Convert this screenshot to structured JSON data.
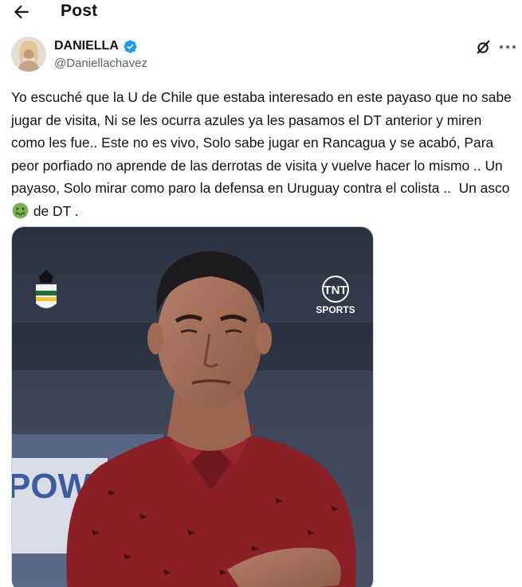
{
  "header": {
    "title": "Post"
  },
  "author": {
    "display_name": "DANIELLA",
    "handle": "@Daniellachavez",
    "verified": true
  },
  "tweet": {
    "text_before_emoji": "Yo escuché que la U de Chile que estaba interesado en este payaso que no sabe jugar de visita, Ni se les ocurra azules ya les pasamos el DT anterior y miren como les fue.. Este no es vivo, Solo sabe jugar en Rancagua y se acabó, Para peor porfiado no aprende de las derrotas de visita y vuelve hacer lo mismo .. Un payaso, Solo mirar como paro la defensa en Uruguay contra el colista ..  Un asco",
    "emoji": "nauseated-face",
    "text_after_emoji": " de DT ."
  },
  "media": {
    "watermark_line1": "TNT",
    "watermark_line2": "SPORTS",
    "background_sign": "POWER"
  },
  "colors": {
    "accent": "#1d9bf0",
    "text": "#0f1419",
    "muted": "#536471",
    "shirt": "#8a1f26"
  }
}
